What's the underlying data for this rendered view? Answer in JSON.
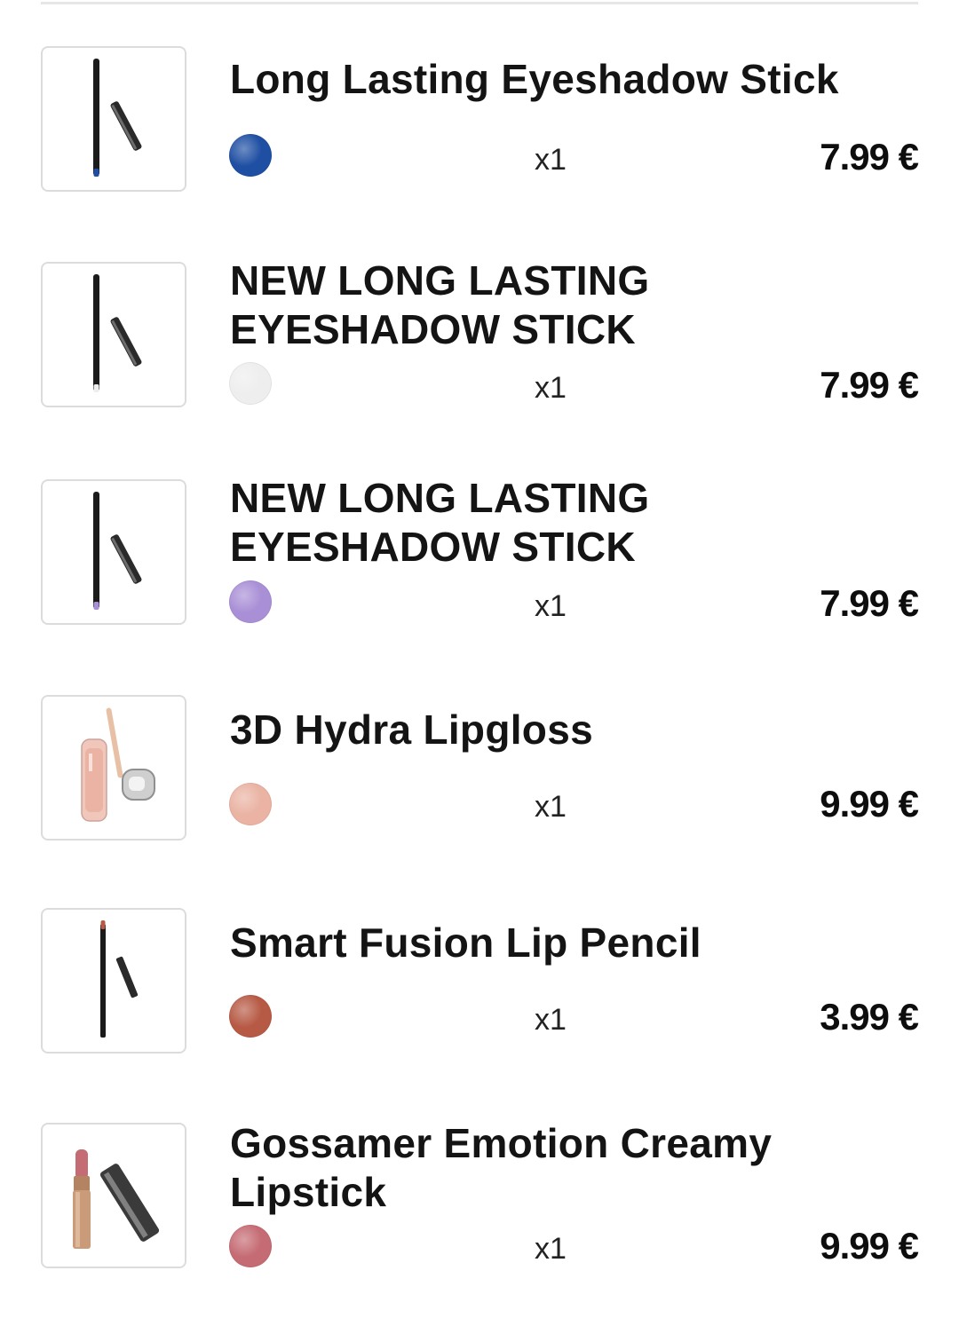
{
  "cart": {
    "items": [
      {
        "name": "Long Lasting Eyeshadow Stick",
        "swatch_color": "#1f4fa3",
        "quantity": "x1",
        "price": "7.99 €",
        "image_icon": "eyeshadow-stick-icon"
      },
      {
        "name": "NEW LONG LASTING\nEYESHADOW STICK",
        "swatch_color": "#eeeeee",
        "quantity": "x1",
        "price": "7.99 €",
        "image_icon": "eyeshadow-stick-icon"
      },
      {
        "name": "NEW LONG LASTING\nEYESHADOW STICK",
        "swatch_color": "#a98fd6",
        "quantity": "x1",
        "price": "7.99 €",
        "image_icon": "eyeshadow-stick-icon"
      },
      {
        "name": "3D Hydra Lipgloss",
        "swatch_color": "#eab3a3",
        "quantity": "x1",
        "price": "9.99 €",
        "image_icon": "lipgloss-icon"
      },
      {
        "name": "Smart Fusion Lip Pencil",
        "swatch_color": "#b75a45",
        "quantity": "x1",
        "price": "3.99 €",
        "image_icon": "lip-pencil-icon"
      },
      {
        "name": "Gossamer Emotion Creamy\nLipstick",
        "swatch_color": "#c56b73",
        "quantity": "x1",
        "price": "9.99 €",
        "image_icon": "lipstick-icon"
      }
    ]
  }
}
